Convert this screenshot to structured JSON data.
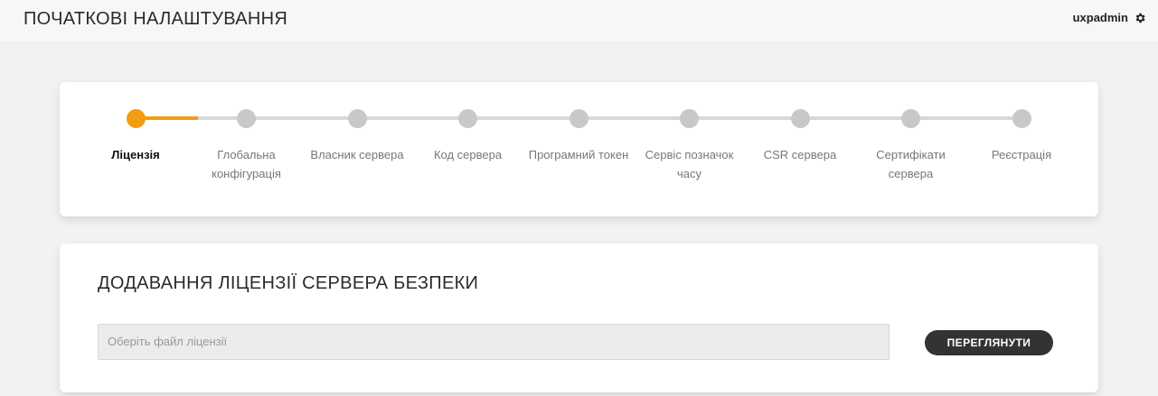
{
  "header": {
    "title": "ПОЧАТКОВІ НАЛАШТУВАННЯ",
    "username": "uxpadmin",
    "settings_icon": "gear-icon"
  },
  "stepper": {
    "active_index": 0,
    "progress_fraction": 0.07,
    "accent_color": "#f39c12",
    "inactive_color": "#c8c8c8",
    "steps": [
      {
        "label": "Ліцензія"
      },
      {
        "label": "Глобальна конфігурація"
      },
      {
        "label": "Власник сервера"
      },
      {
        "label": "Код сервера"
      },
      {
        "label": "Програмний токен"
      },
      {
        "label": "Сервіс позначок часу"
      },
      {
        "label": "CSR сервера"
      },
      {
        "label": "Сертифікати сервера"
      },
      {
        "label": "Реєстрація"
      }
    ]
  },
  "license": {
    "title": "ДОДАВАННЯ ЛІЦЕНЗІЇ СЕРВЕРА БЕЗПЕКИ",
    "file_placeholder": "Оберіть файл ліцензії",
    "file_value": "",
    "browse_label": "ПЕРЕГЛЯНУТИ"
  }
}
